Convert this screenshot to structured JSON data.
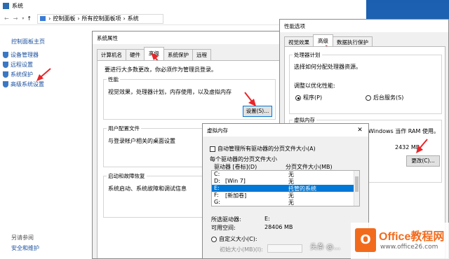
{
  "explorer": {
    "title": "系统",
    "breadcrumb": [
      "控制面板",
      "所有控制面板项",
      "系统"
    ],
    "sidebar_home": "控制面板主页",
    "sidebar_items": [
      "设备管理器",
      "远程设置",
      "系统保护",
      "高级系统设置"
    ],
    "see_also_title": "另请参阅",
    "see_also_items": [
      "安全和维护"
    ]
  },
  "sysprops": {
    "title": "系统属性",
    "tabs": [
      "计算机名",
      "硬件",
      "高级",
      "系统保护",
      "远程"
    ],
    "admin_note": "要进行大多数更改，你必须作为管理员登录。",
    "perf_title": "性能",
    "perf_desc": "视觉效果，处理器计划，内存使用，以及虚拟内存",
    "settings_button": "设置(S)...",
    "profile_title": "用户配置文件",
    "profile_desc": "与登录帐户相关的桌面设置",
    "startup_title": "启动和故障恢复",
    "startup_desc": "系统启动、系统故障和调试信息"
  },
  "perfopts": {
    "title": "性能选项",
    "tabs": [
      "视觉效果",
      "高级",
      "数据执行保护"
    ],
    "sched_title": "处理器计划",
    "sched_desc": "选择如何分配处理器资源。",
    "adjust_label": "调整以优化性能:",
    "opt_programs": "程序(P)",
    "opt_services": "后台服务(S)",
    "vm_title": "虚拟内存",
    "vm_desc": "Windows 当作 RAM 使用。",
    "vm_size": "2432 MB",
    "change_button": "更改(C)..."
  },
  "vmem": {
    "title": "虚拟内存",
    "auto_manage": "自动管理所有驱动器的分页文件大小(A)",
    "per_drive_title": "每个驱动器的分页文件大小",
    "col_drive": "驱动器 [卷标](D)",
    "col_size": "分页文件大小(MB)",
    "rows": [
      {
        "drive": "C:",
        "label": "",
        "size": "无"
      },
      {
        "drive": "D:",
        "label": "[Win 7]",
        "size": "无"
      },
      {
        "drive": "E:",
        "label": "",
        "size": "托管的系统"
      },
      {
        "drive": "F:",
        "label": "[新加卷]",
        "size": "无"
      },
      {
        "drive": "G:",
        "label": "",
        "size": "无"
      }
    ],
    "selected_drive_label": "所选驱动器:",
    "selected_drive_value": "E:",
    "free_space_label": "可用空间:",
    "free_space_value": "28406 MB",
    "custom_size": "自定义大小(C):",
    "initial_size": "初始大小(MB)(I):"
  },
  "watermark": {
    "brand": "Office教程网",
    "url": "www.office26.com",
    "author": "头条 @…"
  },
  "colors": {
    "accent": "#0078d7",
    "arrow": "#e8262a",
    "logo": "#f26b1d"
  }
}
